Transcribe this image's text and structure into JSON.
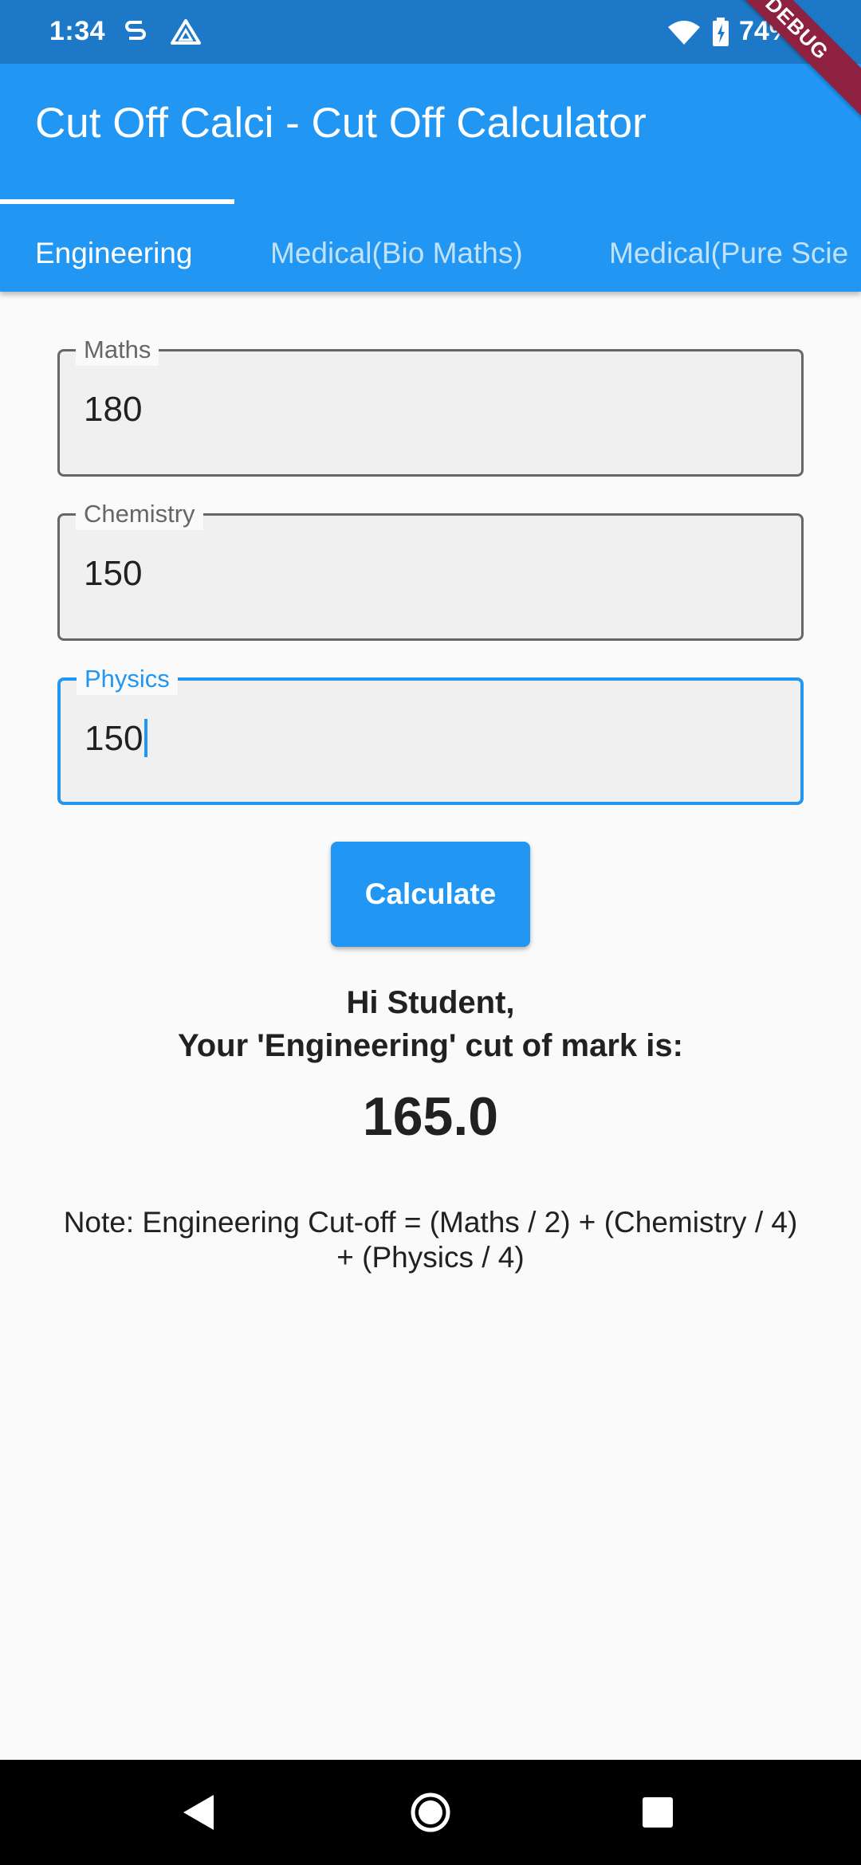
{
  "status_bar": {
    "time": "1:34",
    "battery": "74%",
    "icons": [
      "sim-s-icon",
      "drive-icon",
      "wifi-icon",
      "battery-charging-icon"
    ]
  },
  "debug_banner": "DEBUG",
  "app_bar": {
    "title": "Cut Off Calci - Cut Off Calculator",
    "color": "#2196f3"
  },
  "tabs": [
    {
      "label": "Engineering",
      "active": true
    },
    {
      "label": "Medical(Bio Maths)",
      "active": false
    },
    {
      "label": "Medical(Pure Scie",
      "active": false
    }
  ],
  "form": {
    "maths": {
      "label": "Maths",
      "value": "180"
    },
    "chemistry": {
      "label": "Chemistry",
      "value": "150"
    },
    "physics": {
      "label": "Physics",
      "value": "150"
    }
  },
  "calculate_label": "Calculate",
  "result": {
    "greeting": "Hi Student,",
    "label": "Your 'Engineering' cut of mark is:",
    "value": "165.0"
  },
  "note": "Note: Engineering Cut-off = (Maths / 2) + (Chemistry / 4) + (Physics / 4)",
  "nav": {
    "back": "back-icon",
    "home": "home-icon",
    "recents": "recents-icon"
  }
}
